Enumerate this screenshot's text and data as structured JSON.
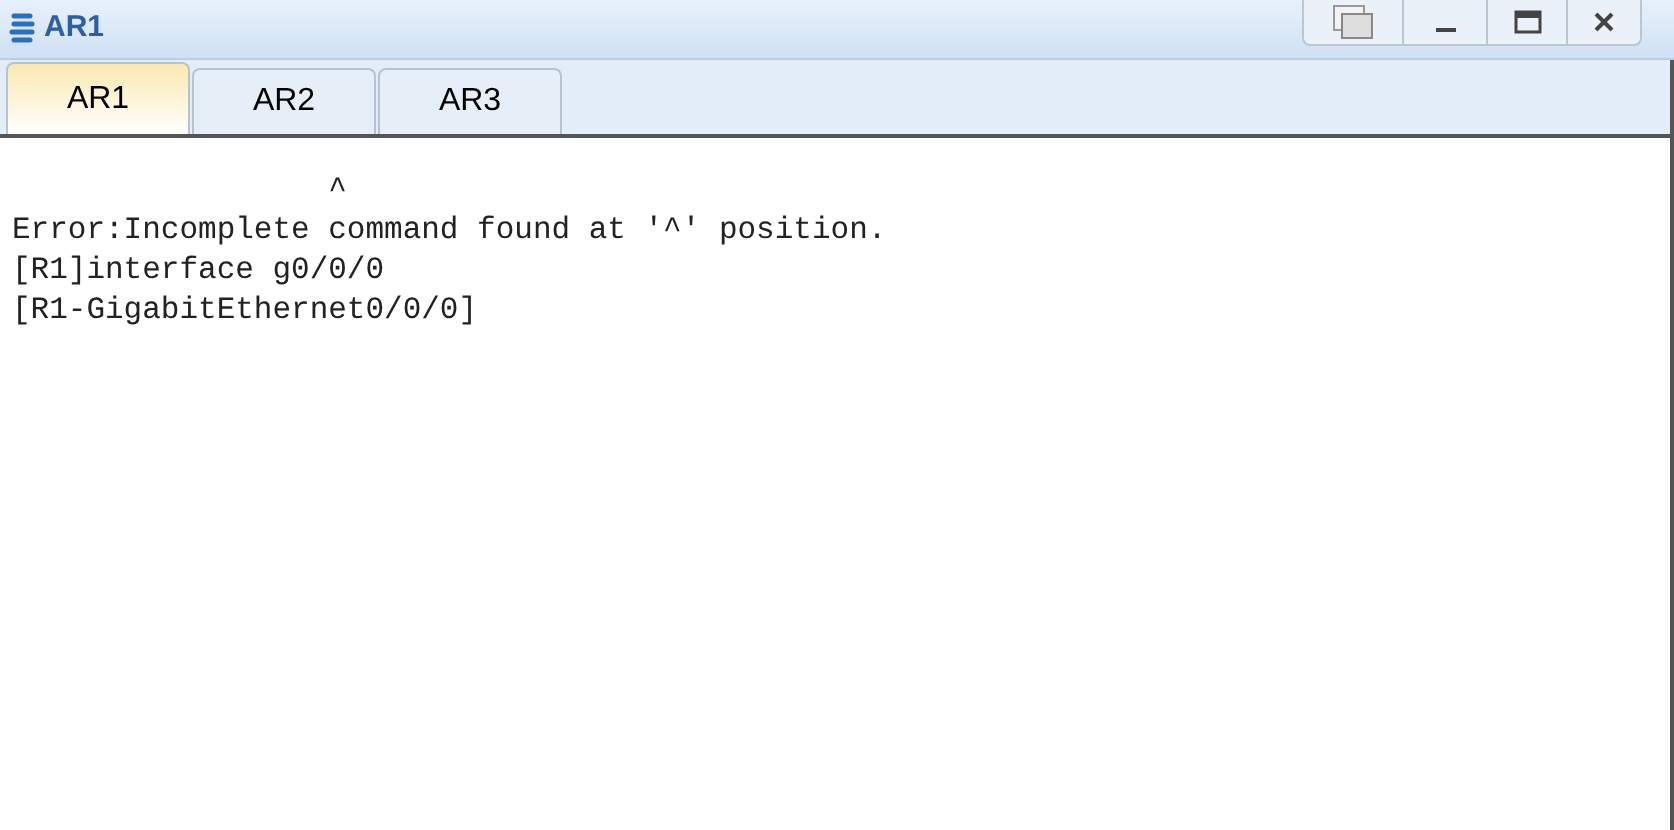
{
  "window": {
    "title": "AR1"
  },
  "tabs": [
    {
      "label": "AR1",
      "selected": true
    },
    {
      "label": "AR2",
      "selected": false
    },
    {
      "label": "AR3",
      "selected": false
    }
  ],
  "console": {
    "lines": [
      "                 ^",
      "Error:Incomplete command found at '^' position.",
      "[R1]interface g0/0/0",
      "[R1-GigabitEthernet0/0/0]"
    ]
  }
}
